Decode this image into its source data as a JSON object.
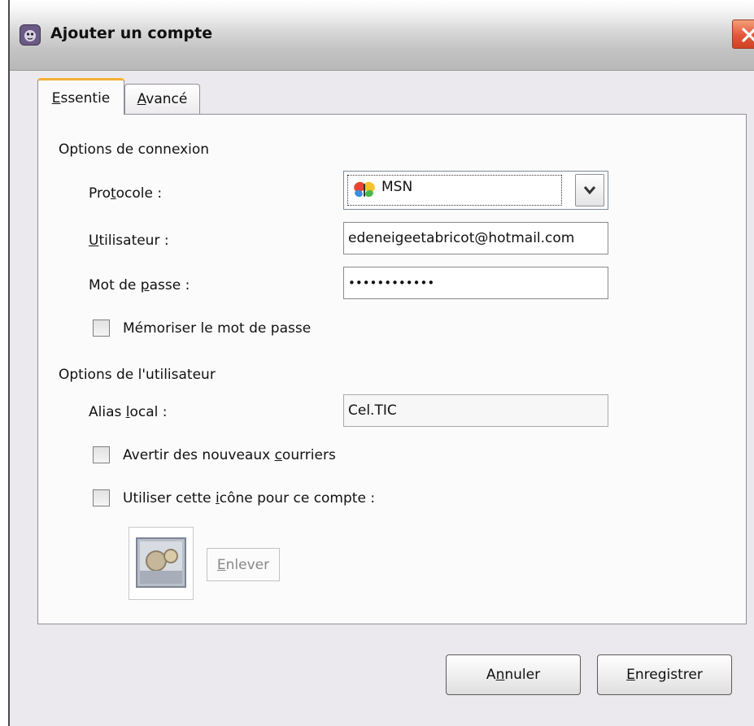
{
  "window": {
    "title": "Ajouter un compte",
    "app_icon": "pidgin-icon",
    "close_icon": "close-icon"
  },
  "tabs": [
    {
      "label_underlined": "E",
      "label_rest": "ssentie",
      "selected": true
    },
    {
      "label_underlined": "A",
      "label_rest": "vancé",
      "selected": false
    }
  ],
  "connection": {
    "section_title": "Options de connexion",
    "protocol_label_pre": "Pro",
    "protocol_label_ul": "t",
    "protocol_label_post": "ocole :",
    "protocol_value": "MSN",
    "protocol_icon": "msn-butterfly-icon",
    "username_label_ul": "U",
    "username_label_post": "tilisateur :",
    "username_value": "edeneigeetabricot@hotmail.com",
    "password_label_pre": "Mot de ",
    "password_label_ul": "p",
    "password_label_post": "asse :",
    "password_value": "••••••••••••",
    "remember_password_label": "Mémoriser le mot de passe",
    "remember_password_checked": false
  },
  "user": {
    "section_title": "Options de l'utilisateur",
    "alias_label_pre": "Alias ",
    "alias_label_ul": "l",
    "alias_label_post": "ocal :",
    "alias_value": "Cel.TIC",
    "new_mail_label_pre": "Avertir des nouveaux ",
    "new_mail_label_ul": "c",
    "new_mail_label_post": "ourriers",
    "new_mail_checked": false,
    "use_icon_label_pre": "Utiliser cette ",
    "use_icon_label_ul": "i",
    "use_icon_label_post": "cône pour ce compte :",
    "use_icon_checked": false,
    "buddy_icon": "buddy-icon-placeholder",
    "remove_ul": "E",
    "remove_post": "nlever"
  },
  "buttons": {
    "cancel_pre": "A",
    "cancel_ul": "n",
    "cancel_post": "nuler",
    "save_ul": "E",
    "save_post": "nregistrer"
  }
}
